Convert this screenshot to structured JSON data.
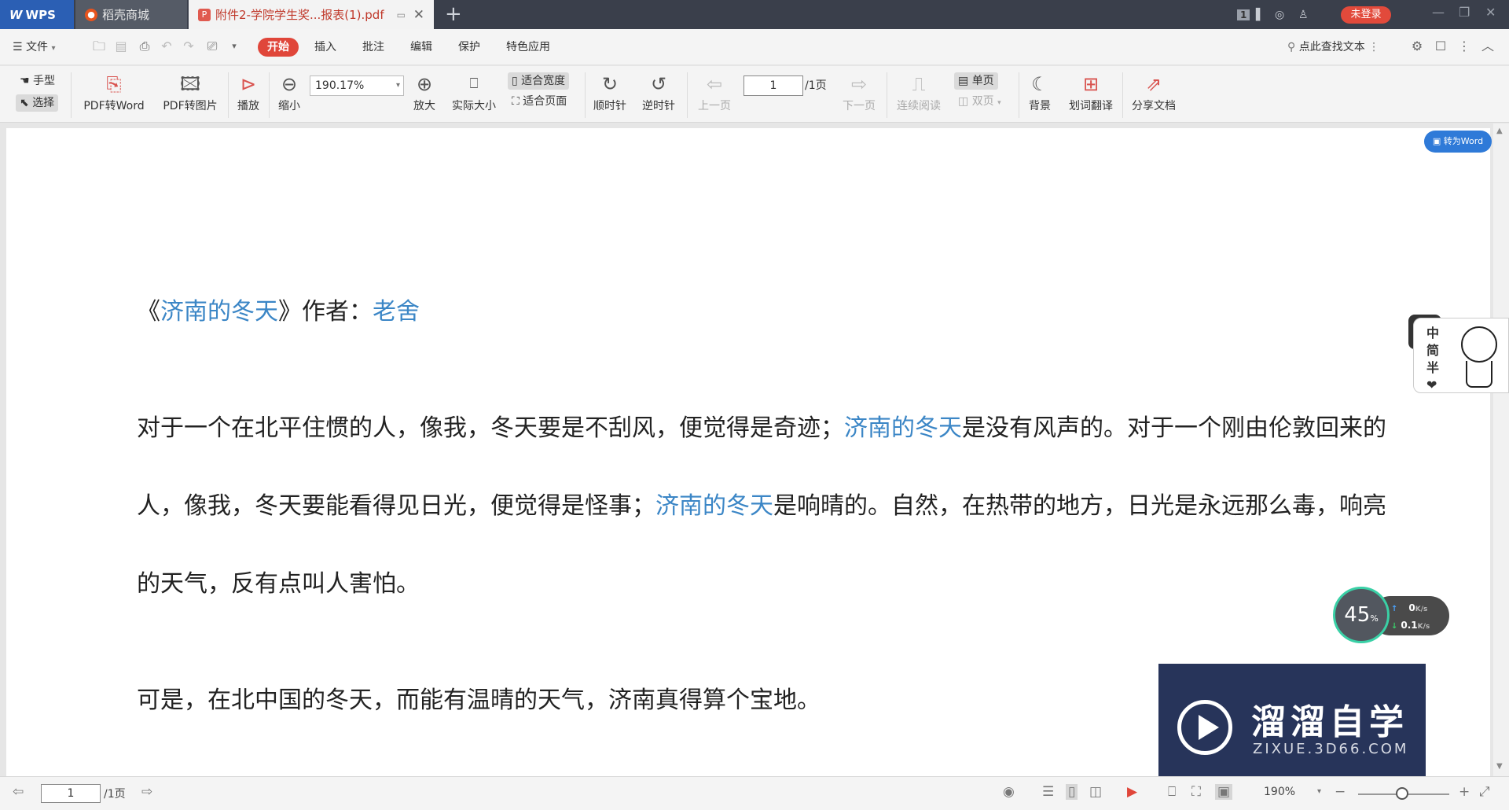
{
  "tabs": {
    "wps_label": "WPS",
    "mall_label": "稻壳商城",
    "pdf_label": "附件2-学院学生奖...报表(1).pdf"
  },
  "titlebar": {
    "badge": "1",
    "login_label": "未登录"
  },
  "menu": {
    "file_label": "文件",
    "items": [
      "开始",
      "插入",
      "批注",
      "编辑",
      "保护",
      "特色应用"
    ],
    "search_label": "点此查找文本"
  },
  "ribbon": {
    "hand_label": "手型",
    "select_label": "选择",
    "pdf_to_word": "PDF转Word",
    "pdf_to_image": "PDF转图片",
    "play": "播放",
    "zoom_out": "缩小",
    "zoom_value": "190.17%",
    "zoom_in": "放大",
    "actual_size": "实际大小",
    "fit_width": "适合宽度",
    "fit_page": "适合页面",
    "rotate_cw": "顺时针",
    "rotate_ccw": "逆时针",
    "prev_page": "上一页",
    "page_value": "1",
    "page_total": "/1页",
    "next_page": "下一页",
    "continuous": "连续阅读",
    "single": "单页",
    "double": "双页",
    "background": "背景",
    "translate": "划词翻译",
    "share": "分享文档"
  },
  "document": {
    "to_word_badge": "转为Word",
    "title_open": "《",
    "title_link": "济南的冬天",
    "title_mid": "》作者：",
    "title_author": "老舍",
    "p1_a": "对于一个在北平住惯的人，像我，冬天要是不刮风，便觉得是奇迹；",
    "p1_link": "济南的冬天",
    "p1_b": "是没有风声的。对于一个刚由伦敦回来的",
    "p2_a": "人，像我，冬天要能看得见日光，便觉得是怪事；",
    "p2_link": "济南的冬天",
    "p2_b": "是响晴的。自然，在热带的地方，日光是永远那么毒，响亮",
    "p3": "的天气，反有点叫人害怕。",
    "p4": "可是，在北中国的冬天，而能有温晴的天气，济南真得算个宝地。"
  },
  "ime_widget": {
    "chars": [
      "中",
      "简",
      "半",
      "❤"
    ]
  },
  "net_widget": {
    "percent": "45",
    "percent_unit": "%",
    "up_value": "0",
    "up_unit": "K/s",
    "down_value": "0.1",
    "down_unit": "K/s"
  },
  "watermark": {
    "title": "溜溜自学",
    "subtitle": "ZIXUE.3D66.COM"
  },
  "statusbar": {
    "page_value": "1",
    "page_total": "/1页",
    "zoom": "190%"
  },
  "colors": {
    "accent_red": "#e0463a",
    "link_blue": "#3b86c6",
    "tab_bar": "#3a3f4b"
  }
}
